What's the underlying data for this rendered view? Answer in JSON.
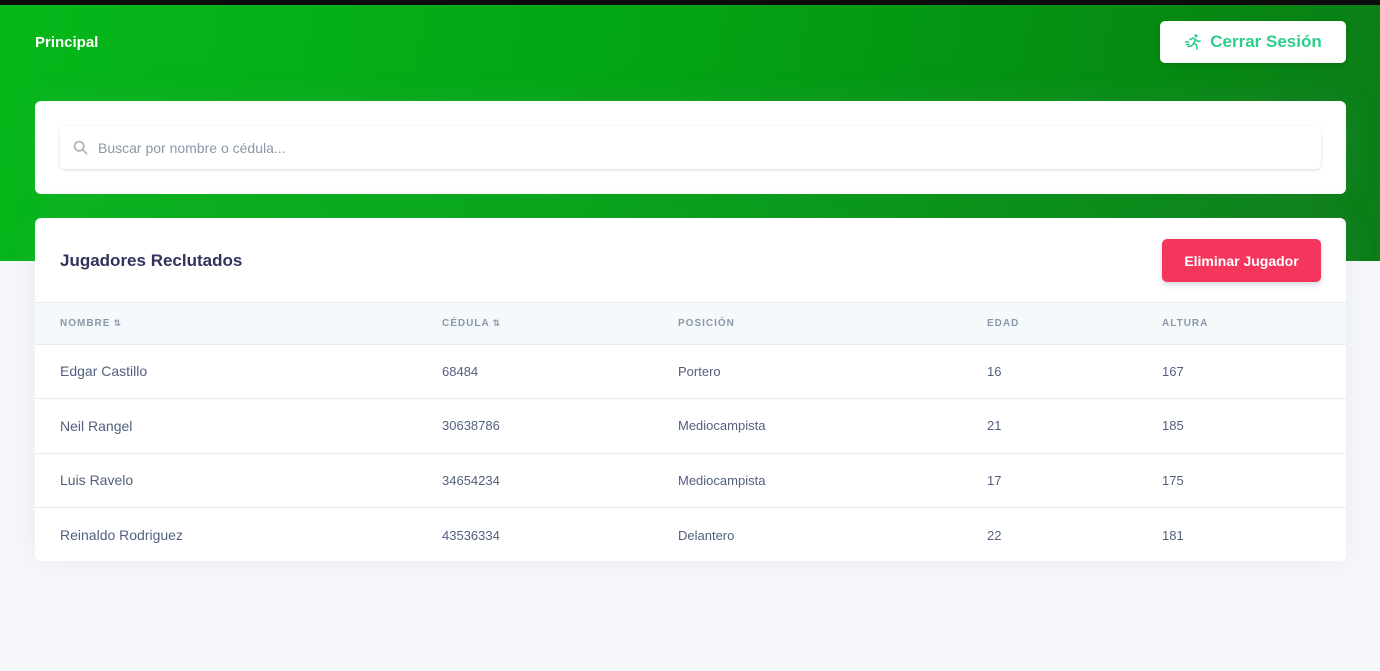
{
  "nav": {
    "brand": "Principal",
    "logout_label": "Cerrar Sesión",
    "logout_icon": "running-person-icon"
  },
  "search": {
    "placeholder": "Buscar por nombre o cédula...",
    "value": "",
    "icon": "search-icon"
  },
  "players": {
    "title": "Jugadores Reclutados",
    "delete_label": "Eliminar Jugador",
    "columns": [
      {
        "label": "Nombre",
        "sortable": true
      },
      {
        "label": "Cédula",
        "sortable": true
      },
      {
        "label": "Posición",
        "sortable": false
      },
      {
        "label": "Edad",
        "sortable": false
      },
      {
        "label": "Altura",
        "sortable": false
      }
    ],
    "rows": [
      [
        "Edgar Castillo",
        "68484",
        "Portero",
        "16",
        "167"
      ],
      [
        "Neil Rangel",
        "30638786",
        "Mediocampista",
        "21",
        "185"
      ],
      [
        "Luis Ravelo",
        "34654234",
        "Mediocampista",
        "17",
        "175"
      ],
      [
        "Reinaldo Rodriguez",
        "43536334",
        "Delantero",
        "22",
        "181"
      ]
    ]
  },
  "colors": {
    "brand_green": "#06b81a",
    "accent_green": "#2dce89",
    "danger": "#f5365c",
    "heading": "#32325d",
    "text": "#525f7f",
    "muted": "#8898aa"
  }
}
